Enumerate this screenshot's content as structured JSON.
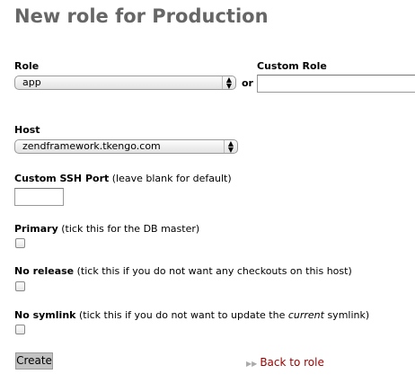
{
  "title": "New role for Production",
  "role": {
    "label": "Role",
    "value": "app",
    "or": "or"
  },
  "custom_role": {
    "label": "Custom Role",
    "value": ""
  },
  "host": {
    "label": "Host",
    "value": "zendframework.tkengo.com"
  },
  "ssh_port": {
    "label": "Custom SSH Port",
    "hint": "(leave blank for default)",
    "value": ""
  },
  "primary": {
    "label": "Primary",
    "hint": "(tick this for the DB master)",
    "checked": false
  },
  "no_release": {
    "label": "No release",
    "hint": "(tick this if you do not want any checkouts on this host)",
    "checked": false
  },
  "no_symlink": {
    "label": "No symlink",
    "hint_pre": "(tick this if you do not want to update the ",
    "hint_em": "current",
    "hint_post": " symlink)",
    "checked": false
  },
  "create_label": "Create",
  "back_link": "Back to role",
  "colors": {
    "title": "#666666",
    "link": "#990000",
    "button": "#c2c2c2"
  }
}
